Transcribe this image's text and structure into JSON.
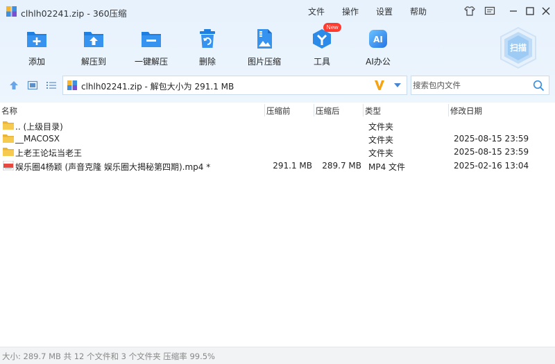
{
  "window": {
    "title": "clhlh02241.zip - 360压缩"
  },
  "menu": {
    "file": "文件",
    "operate": "操作",
    "settings": "设置",
    "help": "帮助"
  },
  "toolbar": {
    "add": "添加",
    "extract_to": "解压到",
    "one_click_extract": "一键解压",
    "delete": "删除",
    "image_compress": "图片压缩",
    "tools": "工具",
    "tools_badge": "New",
    "ai_office": "AI办公",
    "scan": "扫描"
  },
  "address": {
    "text": "clhlh02241.zip - 解包大小为 291.1 MB"
  },
  "search": {
    "placeholder": "搜索包内文件"
  },
  "columns": {
    "name": "名称",
    "size": "压缩前",
    "packed": "压缩后",
    "type": "类型",
    "modified": "修改日期"
  },
  "files": [
    {
      "name": ".. (上级目录)",
      "size": "",
      "packed": "",
      "type": "文件夹",
      "modified": "",
      "icon": "folder-icon"
    },
    {
      "name": "__MACOSX",
      "size": "",
      "packed": "",
      "type": "文件夹",
      "modified": "2025-08-15 23:59",
      "icon": "folder-icon"
    },
    {
      "name": "上老王论坛当老王",
      "size": "",
      "packed": "",
      "type": "文件夹",
      "modified": "2025-08-15 23:59",
      "icon": "folder-icon"
    },
    {
      "name": "娱乐圈4杨颖 (声音克隆  娱乐圈大揭秘第四期).mp4 *",
      "size": "291.1 MB",
      "packed": "289.7 MB",
      "type": "MP4 文件",
      "modified": "2025-02-16 13:04",
      "icon": "video-file-icon"
    }
  ],
  "status": {
    "text": "大小: 289.7 MB 共 12 个文件和 3 个文件夹 压缩率 99.5%"
  },
  "colors": {
    "accent": "#2b8ae5",
    "folder": "#f5c542",
    "badge": "#ff3b30",
    "header_bg": "#e9f3fd"
  }
}
